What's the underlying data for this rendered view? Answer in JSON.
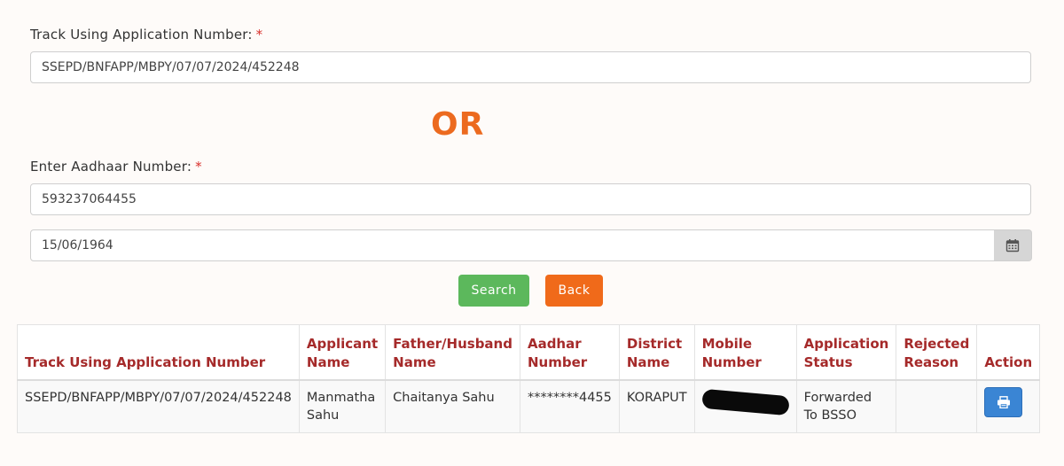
{
  "track": {
    "label": "Track Using Application Number:",
    "required_mark": "*",
    "value": "SSEPD/BNFAPP/MBPY/07/07/2024/452248"
  },
  "or_text": "OR",
  "aadhaar": {
    "label": "Enter Aadhaar Number:",
    "required_mark": "*",
    "value": "593237064455"
  },
  "dob": {
    "value": "15/06/1964",
    "icon": "calendar-icon"
  },
  "buttons": {
    "search": "Search",
    "back": "Back"
  },
  "table": {
    "headers": [
      "Track Using Application Number",
      "Applicant Name",
      "Father/Husband Name",
      "Aadhar Number",
      "District Name",
      "Mobile Number",
      "Application Status",
      "Rejected Reason",
      "Action"
    ],
    "rows": [
      {
        "application_number": "SSEPD/BNFAPP/MBPY/07/07/2024/452248",
        "applicant_name": "Manmatha Sahu",
        "father_husband_name": "Chaitanya Sahu",
        "aadhar_number": "********4455",
        "district_name": "KORAPUT",
        "mobile_number": "",
        "application_status": "Forwarded To BSSO",
        "rejected_reason": "",
        "action_icon": "print-icon"
      }
    ]
  },
  "colors": {
    "or": "#ec6a1f",
    "header_text": "#a52a2a",
    "search_button": "#5cb85c",
    "back_button": "#f06a1a",
    "print_button": "#3a85d4"
  }
}
